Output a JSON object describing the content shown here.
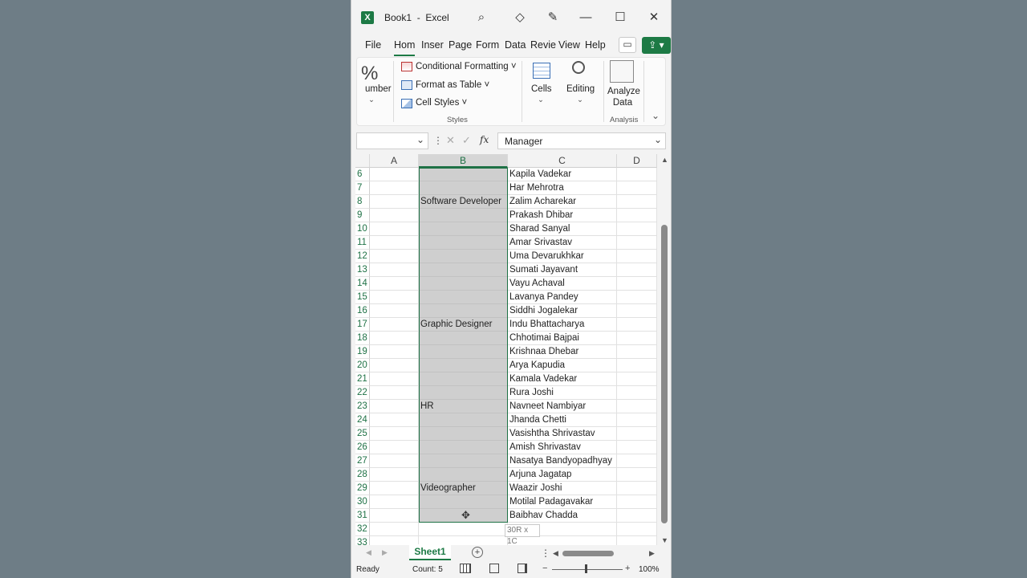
{
  "window": {
    "title": "Book1  -  Excel",
    "app_icon": "excel-logo",
    "icons": [
      "search-icon",
      "diamond-icon",
      "pen-icon",
      "minimize-icon",
      "maximize-icon",
      "close-icon"
    ]
  },
  "tabs": [
    "File",
    "Hom",
    "Inser",
    "Page",
    "Form",
    "Data",
    "Revie",
    "View",
    "Help"
  ],
  "active_tab": "Hom",
  "ribbon": {
    "number_group_glyph": "%",
    "number_group_label": "umber",
    "conditional_formatting": "Conditional Formatting",
    "format_as_table": "Format as Table",
    "cell_styles": "Cell Styles",
    "styles_group_label": "Styles",
    "cells_label": "Cells",
    "editing_label": "Editing",
    "analyze_data_label": "Analyze Data",
    "analysis_group_label": "Analysis"
  },
  "formula_bar": {
    "name_box": "",
    "formula": "Manager",
    "fx": "fx"
  },
  "columns": [
    "A",
    "B",
    "C",
    "D"
  ],
  "rows": [
    {
      "n": "6",
      "b": "",
      "c": "Kapila Vadekar"
    },
    {
      "n": "7",
      "b": "",
      "c": "Har Mehrotra"
    },
    {
      "n": "8",
      "b": "Software Developer",
      "c": "Zalim Acharekar"
    },
    {
      "n": "9",
      "b": "",
      "c": "Prakash Dhibar"
    },
    {
      "n": "10",
      "b": "",
      "c": "Sharad Sanyal"
    },
    {
      "n": "11",
      "b": "",
      "c": "Amar Srivastav"
    },
    {
      "n": "12",
      "b": "",
      "c": "Uma Devarukhkar"
    },
    {
      "n": "13",
      "b": "",
      "c": "Sumati Jayavant"
    },
    {
      "n": "14",
      "b": "",
      "c": "Vayu Achaval"
    },
    {
      "n": "15",
      "b": "",
      "c": "Lavanya Pandey"
    },
    {
      "n": "16",
      "b": "",
      "c": "Siddhi Jogalekar"
    },
    {
      "n": "17",
      "b": "Graphic Designer",
      "c": "Indu Bhattacharya"
    },
    {
      "n": "18",
      "b": "",
      "c": "Chhotimai Bajpai"
    },
    {
      "n": "19",
      "b": "",
      "c": "Krishnaa Dhebar"
    },
    {
      "n": "20",
      "b": "",
      "c": "Arya Kapudia"
    },
    {
      "n": "21",
      "b": "",
      "c": "Kamala Vadekar"
    },
    {
      "n": "22",
      "b": "",
      "c": "Rura Joshi"
    },
    {
      "n": "23",
      "b": "HR",
      "c": "Navneet Nambiyar"
    },
    {
      "n": "24",
      "b": "",
      "c": "Jhanda Chetti"
    },
    {
      "n": "25",
      "b": "",
      "c": "Vasishtha Shrivastav"
    },
    {
      "n": "26",
      "b": "",
      "c": "Amish Shrivastav"
    },
    {
      "n": "27",
      "b": "",
      "c": "Nasatya Bandyopadhyay"
    },
    {
      "n": "28",
      "b": "",
      "c": "Arjuna Jagatap"
    },
    {
      "n": "29",
      "b": "Videographer",
      "c": "Waazir Joshi"
    },
    {
      "n": "30",
      "b": "",
      "c": "Motilal Padagavakar"
    },
    {
      "n": "31",
      "b": "",
      "c": "Baibhav Chadda"
    },
    {
      "n": "32",
      "b": "",
      "c": ""
    },
    {
      "n": "33",
      "b": "",
      "c": ""
    }
  ],
  "selection_tooltip": "30R x 1C",
  "sheets": [
    "Sheet1"
  ],
  "status": {
    "ready": "Ready",
    "count": "Count: 5",
    "zoom": "100%"
  }
}
